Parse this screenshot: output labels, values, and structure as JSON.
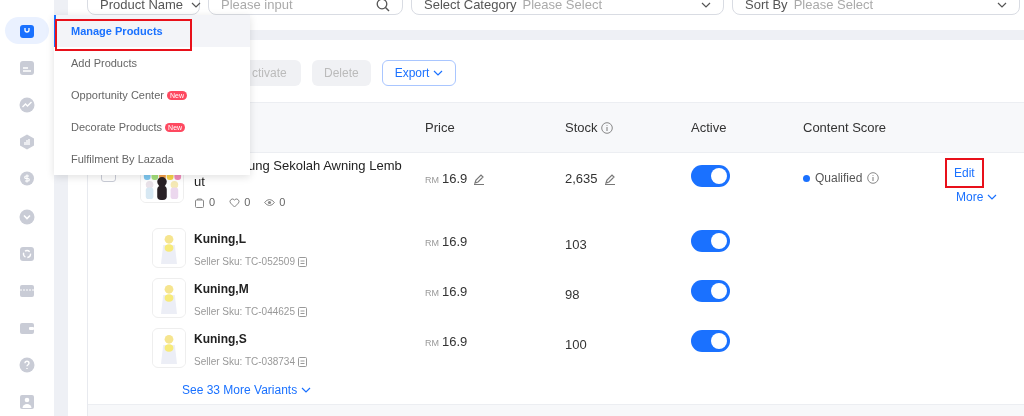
{
  "filters": [
    {
      "kind": "select",
      "label": "Product Name"
    },
    {
      "kind": "search",
      "placeholder": "Please input"
    },
    {
      "kind": "select",
      "label": "Select Category",
      "placeholder": "Please Select"
    },
    {
      "kind": "select",
      "label": "Sort By",
      "placeholder": "Please Select"
    }
  ],
  "sidebar": {
    "items": [
      {
        "selected": true
      },
      {
        "selected": false
      },
      {
        "selected": false
      },
      {
        "selected": false
      },
      {
        "selected": false
      },
      {
        "selected": false
      },
      {
        "selected": false
      },
      {
        "selected": false
      },
      {
        "selected": false
      },
      {
        "selected": false
      },
      {
        "selected": false
      }
    ]
  },
  "menu": {
    "items": [
      {
        "label": "Manage Products",
        "selected": true,
        "highlighted": true
      },
      {
        "label": "Add Products",
        "selected": false,
        "highlighted": false
      },
      {
        "label": "Opportunity Center",
        "badge": "New",
        "selected": false,
        "highlighted": false
      },
      {
        "label": "Decorate Products",
        "badge": "New",
        "selected": false,
        "highlighted": false
      },
      {
        "label": "Fulfilment By Lazada",
        "selected": false,
        "highlighted": false
      }
    ]
  },
  "toolbar": {
    "buttons": [
      {
        "kind": "plain",
        "label": "ctivate",
        "disabled": true
      },
      {
        "kind": "plain",
        "label": "Delete",
        "disabled": true
      },
      {
        "kind": "menu",
        "label": "Export",
        "disabled": false
      }
    ]
  },
  "table": {
    "columns": [
      {
        "kind": "plain",
        "label": "Price"
      },
      {
        "kind": "with_info",
        "label": "Stock"
      },
      {
        "kind": "plain",
        "label": "Active"
      },
      {
        "kind": "plain",
        "label": "Content Score"
      }
    ],
    "product": {
      "checked": false,
      "title_lines": [
        "ung Sekolah Awning Lemb",
        "ut"
      ],
      "stats": [
        {
          "kind": "bag",
          "value": "0"
        },
        {
          "kind": "heart",
          "value": "0"
        },
        {
          "kind": "eye",
          "value": "0"
        }
      ],
      "currency": "RM",
      "price": "16.9",
      "stock": "2,635",
      "active": true,
      "content_score": {
        "label": "Qualified"
      },
      "actions": [
        {
          "kind": "link",
          "label": "Edit",
          "highlighted": true
        },
        {
          "kind": "menu",
          "label": "More",
          "highlighted": false
        }
      ]
    },
    "variants": [
      {
        "name": "Kuning,L",
        "sku": "Seller Sku: TC-052509",
        "currency": "RM",
        "price": "16.9",
        "stock": "103",
        "active": true
      },
      {
        "name": "Kuning,M",
        "sku": "Seller Sku: TC-044625",
        "currency": "RM",
        "price": "16.9",
        "stock": "98",
        "active": true
      },
      {
        "name": "Kuning,S",
        "sku": "Seller Sku: TC-038734",
        "currency": "RM",
        "price": "16.9",
        "stock": "100",
        "active": true
      }
    ],
    "see_more": "See 33 More Variants"
  }
}
